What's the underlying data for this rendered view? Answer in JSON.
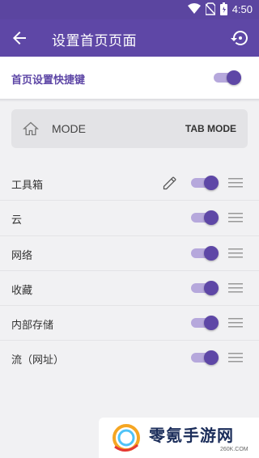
{
  "status_bar": {
    "time": "4:50"
  },
  "app_bar": {
    "title": "设置首页页面"
  },
  "shortcut": {
    "label": "首页设置快捷键",
    "enabled": true
  },
  "mode_card": {
    "mode_label": "MODE",
    "tab_mode_label": "TAB MODE"
  },
  "items": [
    {
      "label": "工具箱",
      "enabled": true,
      "editable": true
    },
    {
      "label": "云",
      "enabled": true,
      "editable": false
    },
    {
      "label": "网络",
      "enabled": true,
      "editable": false
    },
    {
      "label": "收藏",
      "enabled": true,
      "editable": false
    },
    {
      "label": "内部存储",
      "enabled": true,
      "editable": false
    },
    {
      "label": "流（网址）",
      "enabled": true,
      "editable": false
    }
  ],
  "watermark": {
    "text": "零氪手游网",
    "sub": "260K.COM"
  },
  "colors": {
    "primary": "#5e47a6",
    "track": "#b6a8dc",
    "background": "#f1f1f3"
  }
}
